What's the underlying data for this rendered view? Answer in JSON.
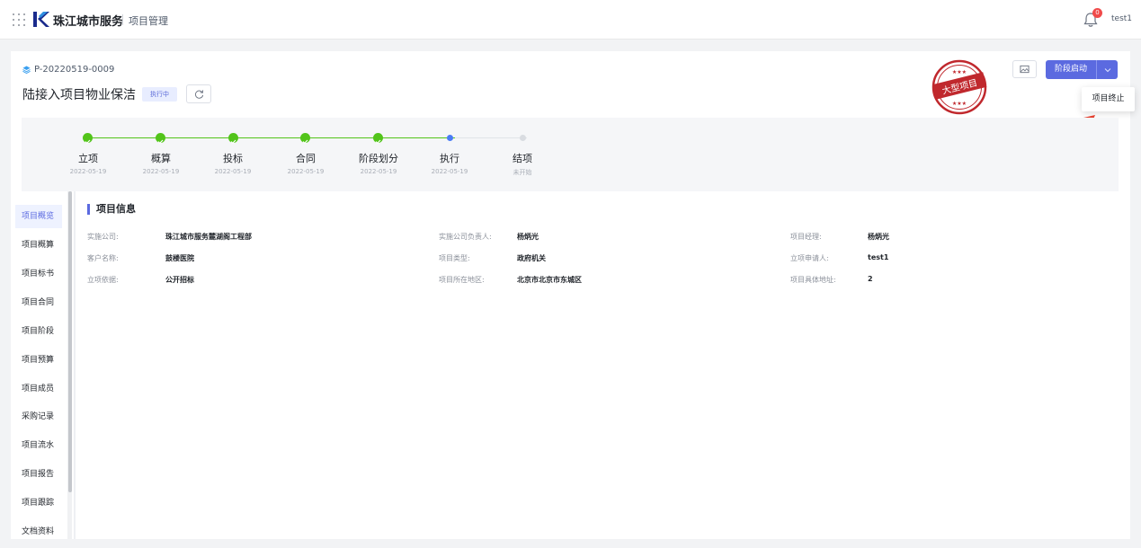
{
  "header": {
    "brand": "珠江城市服务",
    "module": "项目管理",
    "notification_count": "0",
    "username": "test1"
  },
  "project": {
    "code": "P-20220519-0009",
    "title": "陆接入项目物业保洁",
    "status": "执行中",
    "stamp_text": "大型项目"
  },
  "actions": {
    "stage_start": "阶段启动",
    "menu_terminate": "项目终止"
  },
  "steps": [
    {
      "name": "立项",
      "date": "2022-05-19",
      "state": "done"
    },
    {
      "name": "概算",
      "date": "2022-05-19",
      "state": "done"
    },
    {
      "name": "投标",
      "date": "2022-05-19",
      "state": "done"
    },
    {
      "name": "合同",
      "date": "2022-05-19",
      "state": "done"
    },
    {
      "name": "阶段划分",
      "date": "2022-05-19",
      "state": "done"
    },
    {
      "name": "执行",
      "date": "2022-05-19",
      "state": "current"
    },
    {
      "name": "结项",
      "date": "未开始",
      "state": "todo"
    }
  ],
  "sidenav": [
    "项目概览",
    "项目概算",
    "项目标书",
    "项目合同",
    "项目阶段",
    "项目预算",
    "项目成员",
    "采购记录",
    "项目流水",
    "项目报告",
    "项目跟踪",
    "文档资料"
  ],
  "info": {
    "section_title": "项目信息",
    "fields": [
      {
        "label": "实施公司:",
        "value": "珠江城市服务麓湖阁工程部"
      },
      {
        "label": "实施公司负责人:",
        "value": "杨炳光"
      },
      {
        "label": "项目经理:",
        "value": "杨炳光"
      },
      {
        "label": "客户名称:",
        "value": "鼓楼医院"
      },
      {
        "label": "项目类型:",
        "value": "政府机关"
      },
      {
        "label": "立项申请人:",
        "value": "test1"
      },
      {
        "label": "立项依据:",
        "value": "公开招标"
      },
      {
        "label": "项目所在地区:",
        "value": "北京市北京市东城区"
      },
      {
        "label": "项目具体地址:",
        "value": "2"
      }
    ]
  },
  "colors": {
    "accent": "#5b6ae0",
    "done": "#52c41a",
    "current": "#4a7cf5",
    "stamp": "#c0282d"
  }
}
